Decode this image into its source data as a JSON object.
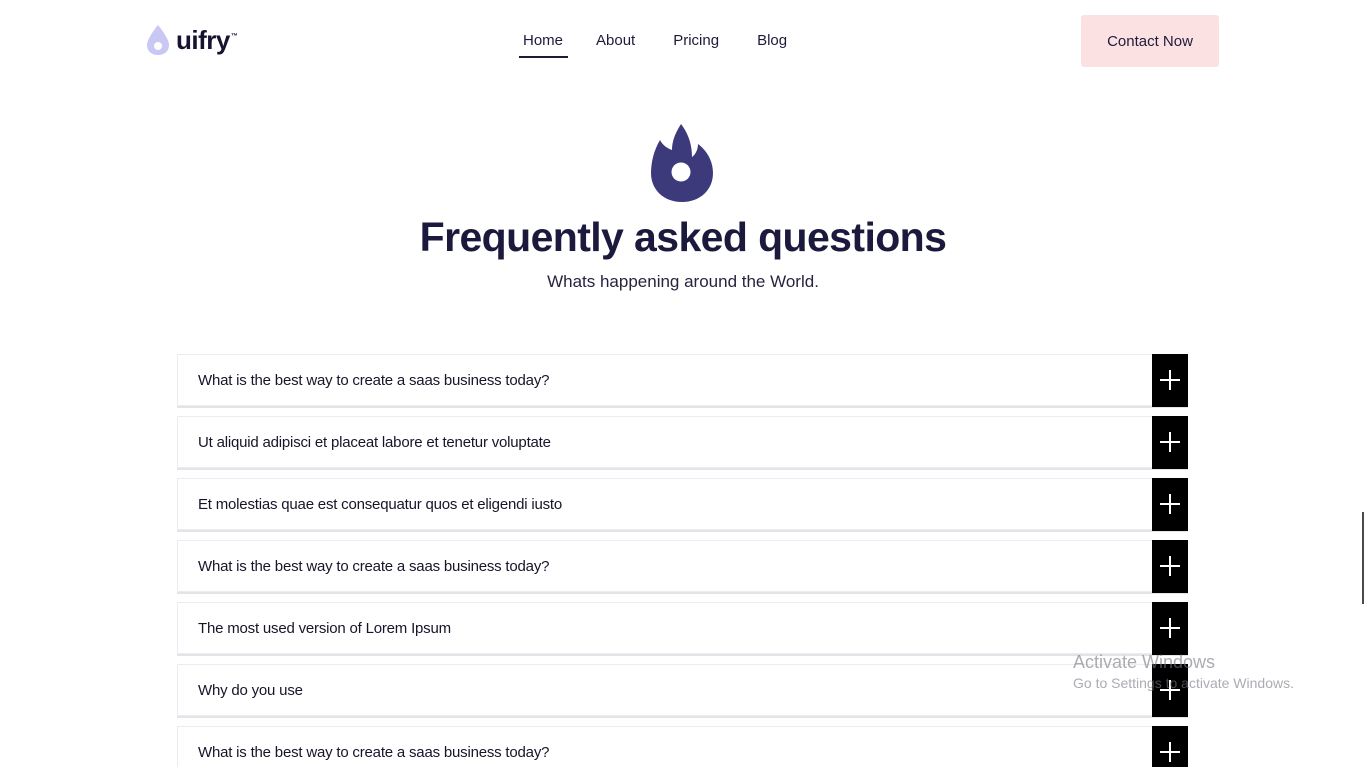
{
  "header": {
    "logo_text": "uifry",
    "logo_tm": "™",
    "nav": [
      {
        "label": "Home",
        "active": true
      },
      {
        "label": "About",
        "active": false
      },
      {
        "label": "Pricing",
        "active": false
      },
      {
        "label": "Blog",
        "active": false
      }
    ],
    "contact_label": "Contact Now"
  },
  "hero": {
    "icon": "flame-icon",
    "title": "Frequently asked questions",
    "subtitle": "Whats happening around the World."
  },
  "faq": {
    "items": [
      {
        "question": "What is the best way to create a saas business today?"
      },
      {
        "question": "Ut aliquid adipisci et placeat labore et tenetur voluptate"
      },
      {
        "question": "Et molestias quae est consequatur quos et eligendi iusto"
      },
      {
        "question": "What is the best way to create a saas business today?"
      },
      {
        "question": "The most used version of Lorem Ipsum"
      },
      {
        "question": "Why do you use"
      },
      {
        "question": "What is the best way to create a saas business today?"
      }
    ],
    "toggle_icon": "plus-icon"
  },
  "watermark": {
    "title": "Activate Windows",
    "subtitle": "Go to Settings to activate Windows."
  },
  "colors": {
    "brand_dark": "#3d3a7c",
    "logo_light": "#c9c8f5",
    "cta_bg": "#fce1e3",
    "toggle_bg": "#000000"
  }
}
